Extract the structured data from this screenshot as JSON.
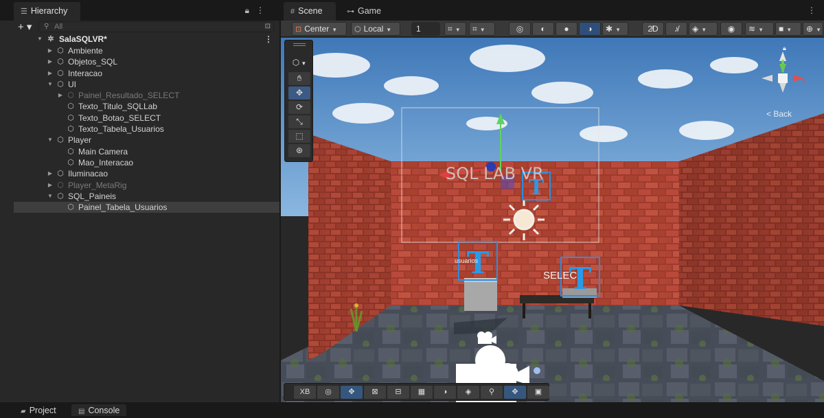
{
  "hierarchy": {
    "tab_label": "Hierarchy",
    "add_label": "+ ▾",
    "search_placeholder": "All",
    "root": "SalaSQLVR*",
    "items": [
      {
        "label": "Ambiente",
        "depth": 1,
        "expanded": false,
        "dim": false
      },
      {
        "label": "Objetos_SQL",
        "depth": 1,
        "expanded": false,
        "dim": false
      },
      {
        "label": "Interacao",
        "depth": 1,
        "expanded": false,
        "dim": false
      },
      {
        "label": "UI",
        "depth": 1,
        "expanded": true,
        "dim": false
      },
      {
        "label": "Painel_Resultado_SELECT",
        "depth": 2,
        "expanded": false,
        "dim": true
      },
      {
        "label": "Texto_Titulo_SQLLab",
        "depth": 2,
        "leaf": true,
        "dim": false
      },
      {
        "label": "Texto_Botao_SELECT",
        "depth": 2,
        "leaf": true,
        "dim": false
      },
      {
        "label": "Texto_Tabela_Usuarios",
        "depth": 2,
        "leaf": true,
        "dim": false
      },
      {
        "label": "Player",
        "depth": 1,
        "expanded": true,
        "dim": false
      },
      {
        "label": "Main Camera",
        "depth": 2,
        "leaf": true,
        "dim": false
      },
      {
        "label": "Mao_Interacao",
        "depth": 2,
        "leaf": true,
        "dim": false
      },
      {
        "label": "Iluminacao",
        "depth": 1,
        "expanded": false,
        "dim": false
      },
      {
        "label": "Player_MetaRig",
        "depth": 1,
        "expanded": false,
        "dim": true
      },
      {
        "label": "SQL_Paineis",
        "depth": 1,
        "expanded": true,
        "dim": false
      },
      {
        "label": "Painel_Tabela_Usuarios",
        "depth": 2,
        "leaf": true,
        "dim": false,
        "selected": true
      }
    ]
  },
  "scene": {
    "tab_scene": "Scene",
    "tab_game": "Game",
    "pivot_label": "Center",
    "space_label": "Local",
    "snap_value": "1",
    "back_label": "Back",
    "scene_title_text": "SQL LAB VR",
    "usuarios_text": "usuarios",
    "select_text": "SELEC",
    "bottom_xb_label": "XB"
  },
  "bottom_tabs": {
    "project": "Project",
    "console": "Console"
  },
  "colors": {
    "accent": "#3c5a84",
    "panel": "#282828",
    "background": "#191919",
    "brick": "#b5473a"
  }
}
